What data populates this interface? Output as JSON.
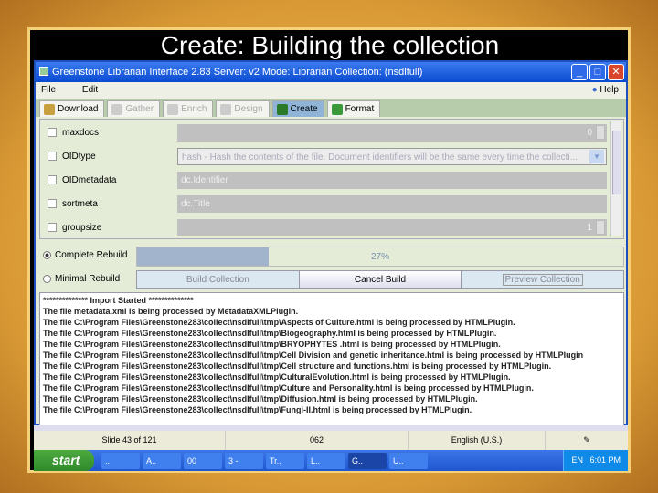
{
  "slide_title": "Create: Building the collection",
  "window": {
    "title": "Greenstone Librarian Interface 2.83  Server: v2  Mode: Librarian  Collection: (nsdlfull)",
    "controls": [
      "_",
      "□",
      "✕"
    ]
  },
  "menu": {
    "items": [
      "File",
      "Edit"
    ],
    "help": "Help"
  },
  "tabs": [
    {
      "label": "Download",
      "state": "normal",
      "color": "#c8a040"
    },
    {
      "label": "Gather",
      "state": "disabled",
      "color": "#ccc"
    },
    {
      "label": "Enrich",
      "state": "disabled",
      "color": "#ccc"
    },
    {
      "label": "Design",
      "state": "disabled",
      "color": "#ccc"
    },
    {
      "label": "Create",
      "state": "active",
      "color": "#2a7a2a"
    },
    {
      "label": "Format",
      "state": "normal",
      "color": "#3a9a3a"
    }
  ],
  "options": [
    {
      "label": "maxdocs",
      "value": "0",
      "kind": "spinner"
    },
    {
      "label": "OIDtype",
      "value": "hash - Hash the contents of the file. Document identifiers will be the same every time the collecti...",
      "kind": "combo"
    },
    {
      "label": "OIDmetadata",
      "value": "dc.Identifier",
      "kind": "text"
    },
    {
      "label": "sortmeta",
      "value": "dc.Title",
      "kind": "text"
    },
    {
      "label": "groupsize",
      "value": "1",
      "kind": "spinner"
    }
  ],
  "build": {
    "complete_rebuild": "Complete Rebuild",
    "minimal_rebuild": "Minimal Rebuild",
    "progress_percent": 27,
    "progress_label": "27%",
    "build_button": "Build Collection",
    "cancel_button": "Cancel Build",
    "preview_button": "Preview Collection"
  },
  "log": [
    "************** Import Started **************",
    "The file metadata.xml is being processed by MetadataXMLPlugin.",
    "The file C:\\Program Files\\Greenstone283\\collect\\nsdlfull\\tmp\\Aspects of Culture.html is being processed by HTMLPlugin.",
    "The file C:\\Program Files\\Greenstone283\\collect\\nsdlfull\\tmp\\Biogeography.html is being processed by HTMLPlugin.",
    "The file C:\\Program Files\\Greenstone283\\collect\\nsdlfull\\tmp\\BRYOPHYTES .html is being processed by HTMLPlugin.",
    "The file C:\\Program Files\\Greenstone283\\collect\\nsdlfull\\tmp\\Cell Division and genetic inheritance.html is being processed by HTMLPlugin",
    "The file C:\\Program Files\\Greenstone283\\collect\\nsdlfull\\tmp\\Cell structure and functions.html is being processed by HTMLPlugin.",
    "The file C:\\Program Files\\Greenstone283\\collect\\nsdlfull\\tmp\\CulturalEvolution.html is being processed by HTMLPlugin.",
    "The file C:\\Program Files\\Greenstone283\\collect\\nsdlfull\\tmp\\Culture and Personality.html is being processed by HTMLPlugin.",
    "The file C:\\Program Files\\Greenstone283\\collect\\nsdlfull\\tmp\\Diffusion.html is being processed by HTMLPlugin.",
    "The file C:\\Program Files\\Greenstone283\\collect\\nsdlfull\\tmp\\Fungi-II.html is being processed by HTMLPlugin."
  ],
  "status": {
    "slide": "Slide 43 of 121",
    "code": "062",
    "language": "English (U.S.)"
  },
  "taskbar": {
    "start": "start",
    "items": [
      "..",
      "A..",
      "00",
      "3 -",
      "Tr..",
      "L..",
      "G..",
      "U.."
    ],
    "active": 6,
    "tray_lang": "EN",
    "clock": "6:01 PM"
  }
}
